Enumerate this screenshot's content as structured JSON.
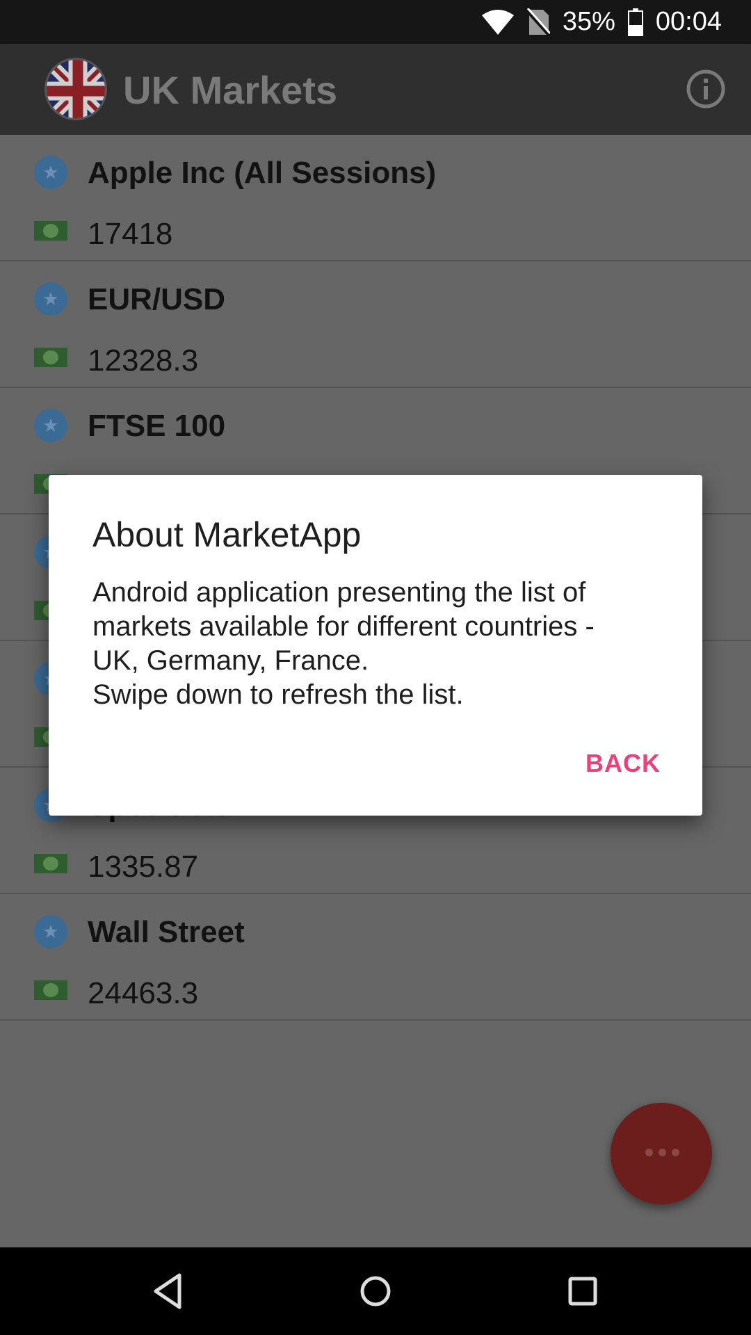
{
  "status_bar": {
    "battery_percent": "35%",
    "time": "00:04"
  },
  "app_bar": {
    "title": "UK Markets",
    "flag_icon": "uk-flag",
    "info_icon": "info-icon"
  },
  "markets": [
    {
      "name": "Apple Inc (All Sessions)",
      "value": "17418"
    },
    {
      "name": "EUR/USD",
      "value": "12328.3"
    },
    {
      "name": "FTSE 100",
      "value": ""
    },
    {
      "name": "",
      "value": ""
    },
    {
      "name": "",
      "value": ""
    },
    {
      "name": "Spot Gold",
      "value": "1335.87"
    },
    {
      "name": "Wall Street",
      "value": "24463.3"
    }
  ],
  "dialog": {
    "title": "About MarketApp",
    "body_lines": [
      "Android application presenting the list of",
      "markets available for different countries -",
      "UK, Germany, France.",
      "Swipe down to refresh the list."
    ],
    "back_label": "BACK"
  },
  "colors": {
    "accent": "#ec407a",
    "fab": "#6b1e1c",
    "app_bar": "#2f2f2f"
  }
}
